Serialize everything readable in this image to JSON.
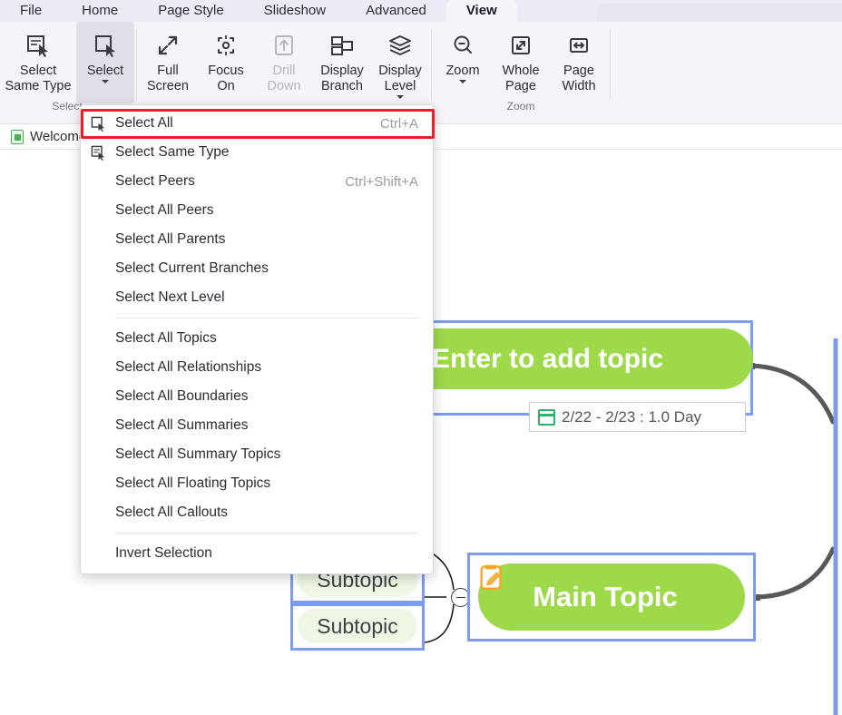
{
  "ribbon": {
    "tabs": [
      {
        "label": "File",
        "active": false
      },
      {
        "label": "Home",
        "active": false
      },
      {
        "label": "Page Style",
        "active": false
      },
      {
        "label": "Slideshow",
        "active": false
      },
      {
        "label": "Advanced",
        "active": false
      },
      {
        "label": "View",
        "active": true
      }
    ],
    "groups": [
      {
        "label": "Select",
        "buttons": [
          {
            "name": "select-same-type-button",
            "label": "Select\nSame Type",
            "icon": "select-same-type-icon",
            "active": false,
            "disabled": false,
            "caret": false,
            "wide": true
          },
          {
            "name": "select-button",
            "label": "Select",
            "icon": "select-icon",
            "active": true,
            "disabled": false,
            "caret": true,
            "wide": false
          }
        ]
      },
      {
        "label": "",
        "buttons": [
          {
            "name": "full-screen-button",
            "label": "Full\nScreen",
            "icon": "full-screen-icon",
            "active": false,
            "disabled": false,
            "caret": false,
            "wide": false
          },
          {
            "name": "focus-on-button",
            "label": "Focus\nOn",
            "icon": "focus-on-icon",
            "active": false,
            "disabled": false,
            "caret": false,
            "wide": false
          },
          {
            "name": "drill-down-button",
            "label": "Drill\nDown",
            "icon": "drill-down-icon",
            "active": false,
            "disabled": true,
            "caret": false,
            "wide": false
          },
          {
            "name": "display-branch-button",
            "label": "Display\nBranch",
            "icon": "display-branch-icon",
            "active": false,
            "disabled": false,
            "caret": false,
            "wide": false
          },
          {
            "name": "display-level-button",
            "label": "Display\nLevel",
            "icon": "display-level-icon",
            "active": false,
            "disabled": false,
            "caret": true,
            "wide": false
          }
        ]
      },
      {
        "label": "Zoom",
        "buttons": [
          {
            "name": "zoom-button",
            "label": "Zoom",
            "icon": "zoom-out-icon",
            "active": false,
            "disabled": false,
            "caret": true,
            "wide": false
          },
          {
            "name": "whole-page-button",
            "label": "Whole\nPage",
            "icon": "whole-page-icon",
            "active": false,
            "disabled": false,
            "caret": false,
            "wide": false
          },
          {
            "name": "page-width-button",
            "label": "Page\nWidth",
            "icon": "page-width-icon",
            "active": false,
            "disabled": false,
            "caret": false,
            "wide": false
          }
        ]
      }
    ]
  },
  "doctabs": [
    {
      "label": "Welcome",
      "icon": "mindmap-file-icon"
    }
  ],
  "menu": {
    "highlighted_index": 0,
    "items": [
      {
        "label": "Select All",
        "shortcut": "Ctrl+A",
        "icon": "select-all-icon",
        "separator_after": false
      },
      {
        "label": "Select Same Type",
        "shortcut": "",
        "icon": "select-same-type-icon",
        "separator_after": false
      },
      {
        "label": "Select Peers",
        "shortcut": "Ctrl+Shift+A",
        "icon": "",
        "separator_after": false
      },
      {
        "label": "Select All Peers",
        "shortcut": "",
        "icon": "",
        "separator_after": false
      },
      {
        "label": "Select All Parents",
        "shortcut": "",
        "icon": "",
        "separator_after": false
      },
      {
        "label": "Select Current Branches",
        "shortcut": "",
        "icon": "",
        "separator_after": false
      },
      {
        "label": "Select Next Level",
        "shortcut": "",
        "icon": "",
        "separator_after": true
      },
      {
        "label": "Select All Topics",
        "shortcut": "",
        "icon": "",
        "separator_after": false
      },
      {
        "label": "Select All Relationships",
        "shortcut": "",
        "icon": "",
        "separator_after": false
      },
      {
        "label": "Select All Boundaries",
        "shortcut": "",
        "icon": "",
        "separator_after": false
      },
      {
        "label": "Select All Summaries",
        "shortcut": "",
        "icon": "",
        "separator_after": false
      },
      {
        "label": "Select All Summary Topics",
        "shortcut": "",
        "icon": "",
        "separator_after": false
      },
      {
        "label": "Select All Floating Topics",
        "shortcut": "",
        "icon": "",
        "separator_after": false
      },
      {
        "label": "Select All Callouts",
        "shortcut": "",
        "icon": "",
        "separator_after": true
      },
      {
        "label": "Invert Selection",
        "shortcut": "",
        "icon": "",
        "separator_after": false
      }
    ]
  },
  "canvas": {
    "topic_add": {
      "label": "Enter to add topic",
      "attachment_icon": "paperclip-icon"
    },
    "date_label": {
      "text": "2/22 - 2/23 : 1.0 Day",
      "icon": "calendar-icon"
    },
    "main_topic": {
      "label": "Main Topic",
      "note_icon": "note-edit-icon"
    },
    "subtopics": [
      {
        "label": "Subtopic"
      },
      {
        "label": "Subtopic"
      },
      {
        "label": "Subtopic"
      }
    ]
  },
  "colors": {
    "topic_green": "#9ed94a",
    "subtopic_green": "#eef7e4",
    "selection_blue": "#7b9cf0",
    "highlight_red": "#ee1c25",
    "ribbon_bg": "#f4f4f9",
    "tabbar_bg": "#eceaf4"
  }
}
